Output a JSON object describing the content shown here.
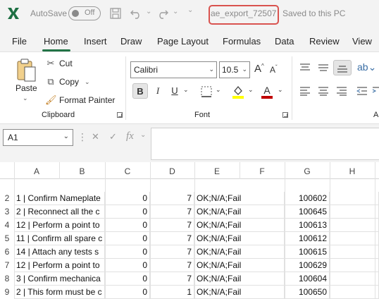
{
  "titlebar": {
    "autosave_label": "AutoSave",
    "autosave_state": "Off",
    "filename": "ae_export_72507",
    "save_status": "Saved to this PC",
    "icons": [
      "excel-logo-icon",
      "save-icon",
      "undo-icon",
      "redo-icon",
      "customize-chevron-icon"
    ]
  },
  "tabs": [
    "File",
    "Home",
    "Insert",
    "Draw",
    "Page Layout",
    "Formulas",
    "Data",
    "Review",
    "View"
  ],
  "active_tab": "Home",
  "ribbon": {
    "clipboard": {
      "paste": "Paste",
      "cut": "Cut",
      "copy": "Copy",
      "format_painter": "Format Painter",
      "label": "Clipboard"
    },
    "font": {
      "name": "Calibri",
      "size": "10.5",
      "bold": "B",
      "italic": "I",
      "underline": "U",
      "label": "Font",
      "font_color": "#c00000",
      "highlight_color": "#ffff00"
    },
    "alignment": {
      "label": "A"
    }
  },
  "formula_bar": {
    "name_box": "A1",
    "fx": "fx",
    "formula": ""
  },
  "columns": [
    "A",
    "B",
    "C",
    "D",
    "E",
    "F",
    "G",
    "H"
  ],
  "rows": [
    {
      "num": "2",
      "a": "1 | Confirm Nameplate",
      "c": "0",
      "d": "7",
      "e": "OK;N/A;Fail",
      "g": "100602"
    },
    {
      "num": "3",
      "a": "2 | Reconnect all the c",
      "c": "0",
      "d": "7",
      "e": "OK;N/A;Fail",
      "g": "100645"
    },
    {
      "num": "4",
      "a": "12 | Perform a point to",
      "c": "0",
      "d": "7",
      "e": "OK;N/A;Fail",
      "g": "100613"
    },
    {
      "num": "5",
      "a": "11 | Confirm all spare c",
      "c": "0",
      "d": "7",
      "e": "OK;N/A;Fail",
      "g": "100612"
    },
    {
      "num": "6",
      "a": "14 | Attach any tests s",
      "c": "0",
      "d": "7",
      "e": "OK;N/A;Fail",
      "g": "100615"
    },
    {
      "num": "7",
      "a": "12 | Perform a point to",
      "c": "0",
      "d": "7",
      "e": "OK;N/A;Fail",
      "g": "100629"
    },
    {
      "num": "8",
      "a": "3 | Confirm mechanica",
      "c": "0",
      "d": "7",
      "e": "OK;N/A;Fail",
      "g": "100604"
    },
    {
      "num": "9",
      "a": "2 | This form must be c",
      "c": "0",
      "d": "1",
      "e": "OK;N/A;Fail",
      "g": "100650"
    }
  ]
}
